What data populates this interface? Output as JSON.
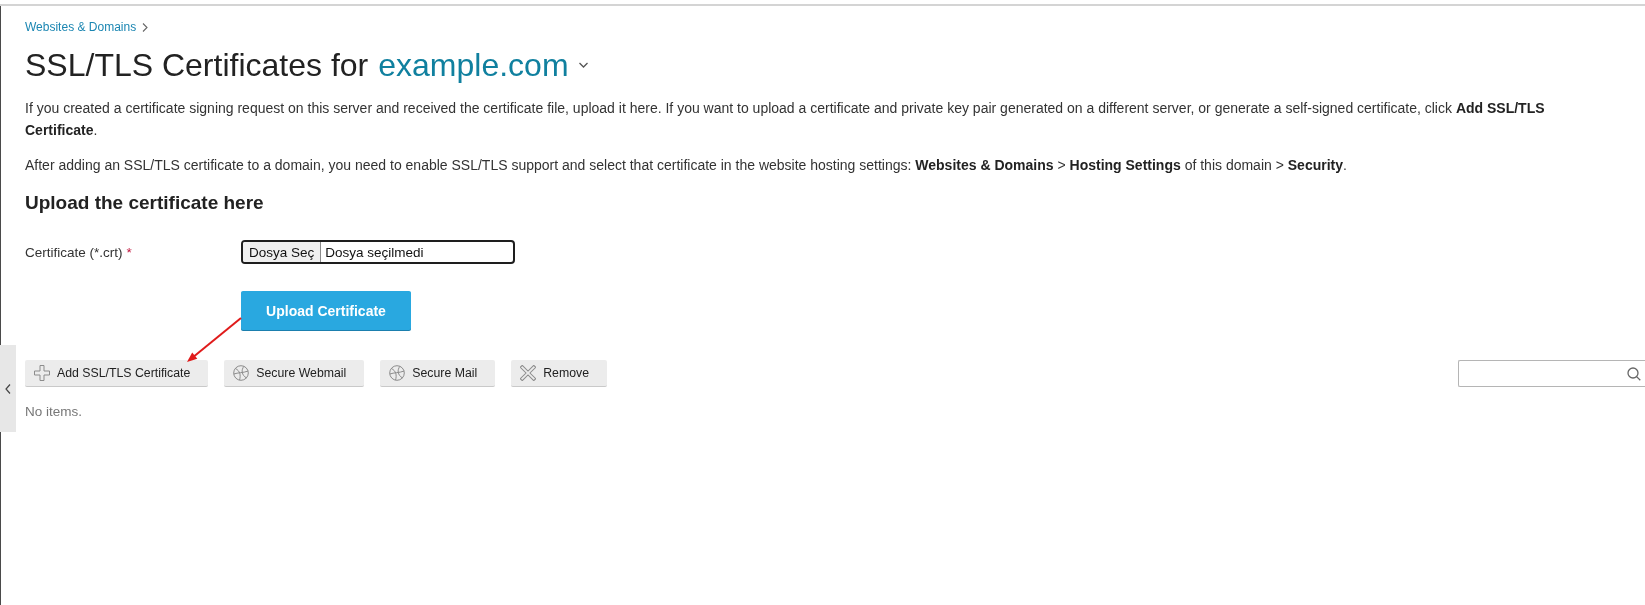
{
  "breadcrumbs": [
    {
      "label": "Websites & Domains"
    }
  ],
  "title": {
    "text": "SSL/TLS Certificates for",
    "domain": "example.com"
  },
  "intro": [
    "If you created a certificate signing request on this server and received the certificate file, upload it here. If you want to upload a certificate and private key pair generated on a different server, or generate a self-signed certificate, click **Add SSL/TLS Certificate**.",
    "After adding an SSL/TLS certificate to a domain, you need to enable SSL/TLS support and select that certificate in the website hosting settings: **Websites & Domains** > **Hosting Settings** of this domain > **Security**."
  ],
  "upload_form": {
    "heading": "Upload the certificate here",
    "fields": [
      {
        "kind": "file",
        "label": "Certificate (*.crt)",
        "required_mark": "*",
        "button": "Dosya Seç",
        "file_status": "Dosya seçilmedi"
      }
    ],
    "submit": "Upload Certificate"
  },
  "toolbar": {
    "buttons": [
      {
        "kind": "add",
        "label": "Add SSL/TLS Certificate"
      },
      {
        "kind": "secure",
        "label": "Secure Webmail"
      },
      {
        "kind": "secure",
        "label": "Secure Mail"
      },
      {
        "kind": "remove",
        "label": "Remove"
      }
    ]
  },
  "list": {
    "empty_text": "No items."
  }
}
